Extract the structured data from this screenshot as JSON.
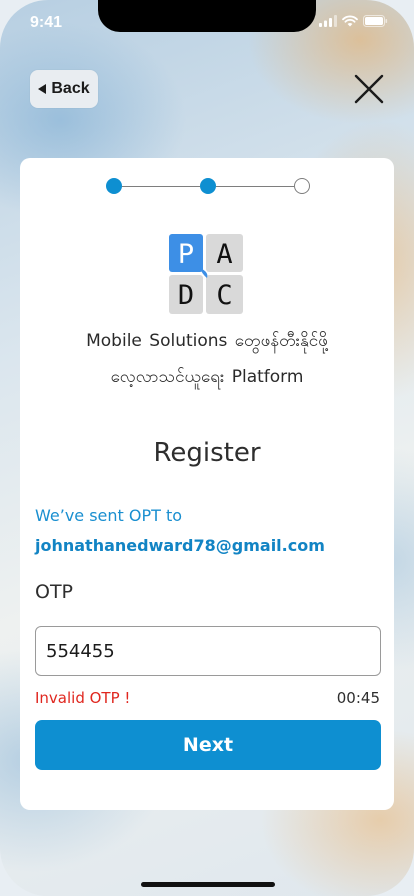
{
  "status_bar": {
    "time": "9:41"
  },
  "nav": {
    "back_label": "Back",
    "back_icon": "triangle-left-icon",
    "close_icon": "close-x-icon"
  },
  "stepper": {
    "total_steps": 3,
    "completed_steps": 2
  },
  "logo": {
    "letters": [
      "P",
      "A",
      "D",
      "C"
    ],
    "accent": "#3d8fe6",
    "tile_color": "#d9d9d9"
  },
  "tagline": {
    "line1": "Mobile  Solutions  တွေဖန်တီးနိုင်ဖို့",
    "line2": "လေ့လာသင်ယူရေး  Platform"
  },
  "page": {
    "title": "Register"
  },
  "otp_info": {
    "sent_label": "We’ve sent OPT to",
    "email": "johnathanedward78@gmail.com"
  },
  "otp_field": {
    "label": "OTP",
    "value": "554455"
  },
  "validation": {
    "error": "Invalid OTP !",
    "timer": "00:45"
  },
  "actions": {
    "next_label": "Next"
  },
  "colors": {
    "primary": "#0e8fd1",
    "error": "#e0271f"
  }
}
